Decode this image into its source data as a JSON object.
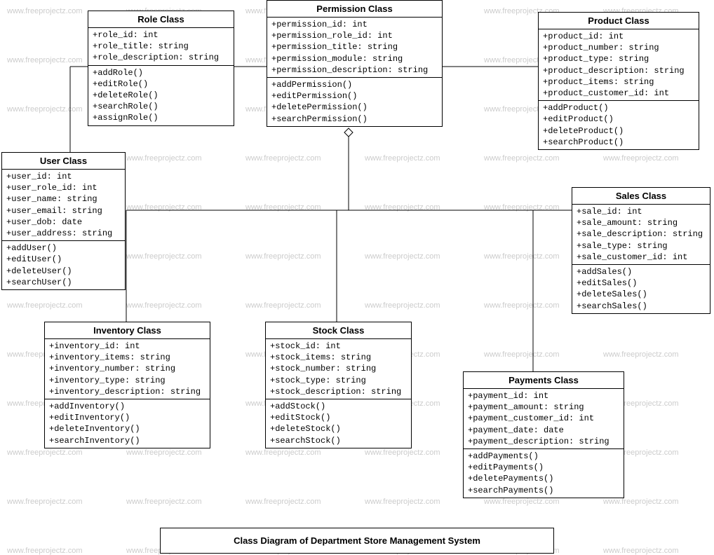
{
  "diagram_title": "Class Diagram of Department Store Management System",
  "watermark_text": "www.freeprojectz.com",
  "classes": {
    "role": {
      "title": "Role Class",
      "attrs": [
        "+role_id: int",
        "+role_title: string",
        "+role_description: string"
      ],
      "ops": [
        "+addRole()",
        "+editRole()",
        "+deleteRole()",
        "+searchRole()",
        "+assignRole()"
      ]
    },
    "permission": {
      "title": "Permission Class",
      "attrs": [
        "+permission_id: int",
        "+permission_role_id: int",
        "+permission_title: string",
        "+permission_module: string",
        "+permission_description: string"
      ],
      "ops": [
        "+addPermission()",
        "+editPermission()",
        "+deletePermission()",
        "+searchPermission()"
      ]
    },
    "product": {
      "title": "Product Class",
      "attrs": [
        "+product_id: int",
        "+product_number: string",
        "+product_type: string",
        "+product_description: string",
        "+product_items: string",
        "+product_customer_id: int"
      ],
      "ops": [
        "+addProduct()",
        "+editProduct()",
        "+deleteProduct()",
        "+searchProduct()"
      ]
    },
    "user": {
      "title": "User Class",
      "attrs": [
        "+user_id: int",
        "+user_role_id: int",
        "+user_name: string",
        "+user_email: string",
        "+user_dob: date",
        "+user_address: string"
      ],
      "ops": [
        "+addUser()",
        "+editUser()",
        "+deleteUser()",
        "+searchUser()"
      ]
    },
    "sales": {
      "title": "Sales Class",
      "attrs": [
        "+sale_id: int",
        "+sale_amount: string",
        "+sale_description: string",
        "+sale_type: string",
        "+sale_customer_id: int"
      ],
      "ops": [
        "+addSales()",
        "+editSales()",
        "+deleteSales()",
        "+searchSales()"
      ]
    },
    "inventory": {
      "title": "Inventory Class",
      "attrs": [
        "+inventory_id: int",
        "+inventory_items: string",
        "+inventory_number: string",
        "+inventory_type: string",
        "+inventory_description: string"
      ],
      "ops": [
        "+addInventory()",
        "+editInventory()",
        "+deleteInventory()",
        "+searchInventory()"
      ]
    },
    "stock": {
      "title": "Stock Class",
      "attrs": [
        "+stock_id: int",
        "+stock_items: string",
        "+stock_number: string",
        "+stock_type: string",
        "+stock_description: string"
      ],
      "ops": [
        "+addStock()",
        "+editStock()",
        "+deleteStock()",
        "+searchStock()"
      ]
    },
    "payments": {
      "title": "Payments Class",
      "attrs": [
        "+payment_id: int",
        "+payment_amount: string",
        "+payment_customer_id: int",
        "+payment_date: date",
        "+payment_description: string"
      ],
      "ops": [
        "+addPayments()",
        "+editPayments()",
        "+deletePayments()",
        "+searchPayments()"
      ]
    }
  }
}
